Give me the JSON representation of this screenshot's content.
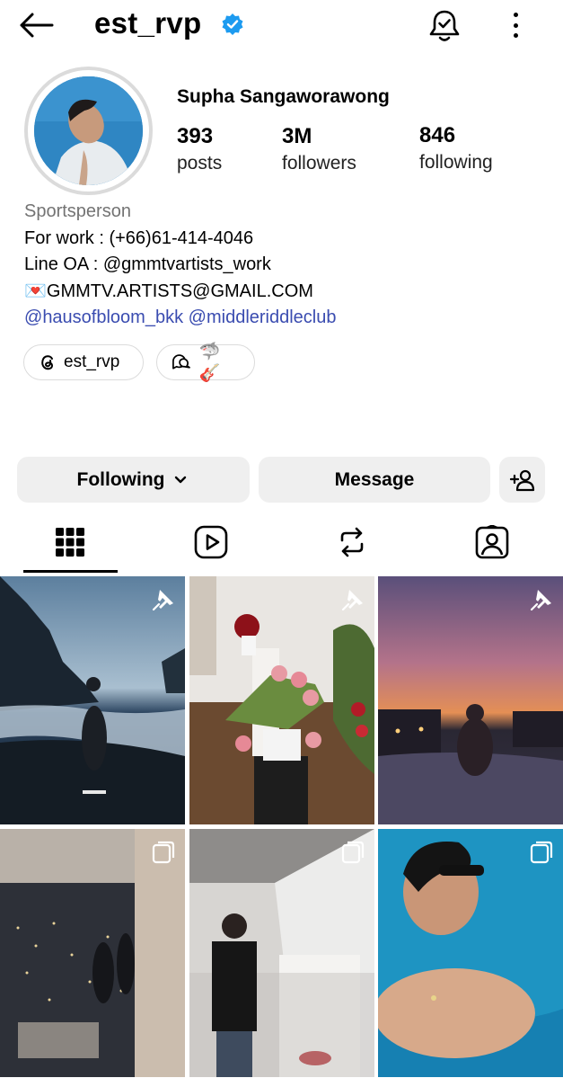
{
  "header": {
    "username": "est_rvp",
    "icons": {
      "back": "arrow-left-icon",
      "verified": "verified-badge-icon",
      "notifications": "bell-check-icon",
      "more": "more-vertical-icon"
    }
  },
  "profile": {
    "full_name": "Supha Sangaworawong",
    "stats": [
      {
        "value": "393",
        "label": "posts"
      },
      {
        "value": "3M",
        "label": "followers"
      },
      {
        "value": "846",
        "label": "following"
      }
    ],
    "bio": {
      "category": "Sportsperson",
      "line1": "For work : (+66)61-414-4046",
      "line2_prefix": "Line OA : ",
      "line2_handle": "gmmtvartists_work",
      "line3_emoji": "💌",
      "line3_text": "GMMTV.ARTISTS@GMAIL.COM",
      "link1": "hausofbloom_bkk",
      "link2": "middleriddleclub"
    },
    "chips": [
      {
        "label": "est_rvp",
        "icon": "threads-icon"
      },
      {
        "label": "🦈🎸",
        "icon": "chat-bubbles-icon"
      }
    ]
  },
  "actions": {
    "following_label": "Following",
    "message_label": "Message",
    "add_person_icon": "add-person-icon"
  },
  "tabs": [
    {
      "name": "grid",
      "icon": "grid-icon",
      "active": true
    },
    {
      "name": "reels",
      "icon": "reels-icon",
      "active": false
    },
    {
      "name": "reposts",
      "icon": "repost-icon",
      "active": false
    },
    {
      "name": "tagged",
      "icon": "tagged-icon",
      "active": false
    }
  ],
  "posts": [
    {
      "badge": "pin-icon"
    },
    {
      "badge": "pin-icon"
    },
    {
      "badge": "pin-icon"
    },
    {
      "badge": "carousel-icon"
    },
    {
      "badge": "carousel-icon"
    },
    {
      "badge": "carousel-icon"
    }
  ],
  "colors": {
    "link": "#3a4cb0",
    "verified": "#1d9bf0",
    "button_bg": "#efefef",
    "muted": "#737373"
  }
}
